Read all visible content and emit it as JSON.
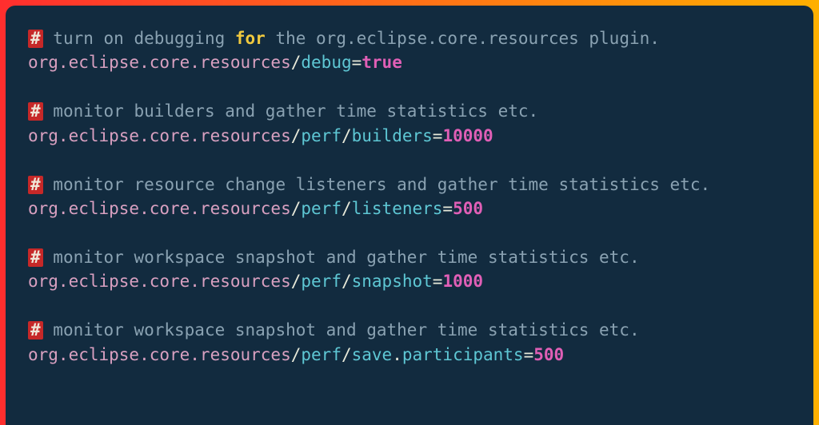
{
  "blocks": [
    {
      "comment": {
        "hash": "#",
        "pre": " turn on debugging ",
        "kw": "for",
        "post": " the org.eclipse.core.resources plugin."
      },
      "setting": {
        "path": "org.eclipse.core.resources",
        "sep1": "/",
        "seg1": "debug",
        "eq": "=",
        "value": "true"
      }
    },
    {
      "comment": {
        "hash": "#",
        "text": " monitor builders and gather time statistics etc."
      },
      "setting": {
        "path": "org.eclipse.core.resources",
        "sep1": "/",
        "seg1": "perf",
        "sep2": "/",
        "seg2": "builders",
        "eq": "=",
        "value": "10000"
      }
    },
    {
      "comment": {
        "hash": "#",
        "text": " monitor resource change listeners and gather time statistics etc."
      },
      "setting": {
        "path": "org.eclipse.core.resources",
        "sep1": "/",
        "seg1": "perf",
        "sep2": "/",
        "seg2": "listeners",
        "eq": "=",
        "value": "500"
      }
    },
    {
      "comment": {
        "hash": "#",
        "text": " monitor workspace snapshot and gather time statistics etc."
      },
      "setting": {
        "path": "org.eclipse.core.resources",
        "sep1": "/",
        "seg1": "perf",
        "sep2": "/",
        "seg2": "snapshot",
        "eq": "=",
        "value": "1000"
      }
    },
    {
      "comment": {
        "hash": "#",
        "text": " monitor workspace snapshot and gather time statistics etc."
      },
      "setting": {
        "path": "org.eclipse.core.resources",
        "sep1": "/",
        "seg1": "perf",
        "sep2": "/",
        "seg2": "save",
        "sep3": ".",
        "seg3": "participants",
        "eq": "=",
        "value": "500"
      }
    }
  ]
}
